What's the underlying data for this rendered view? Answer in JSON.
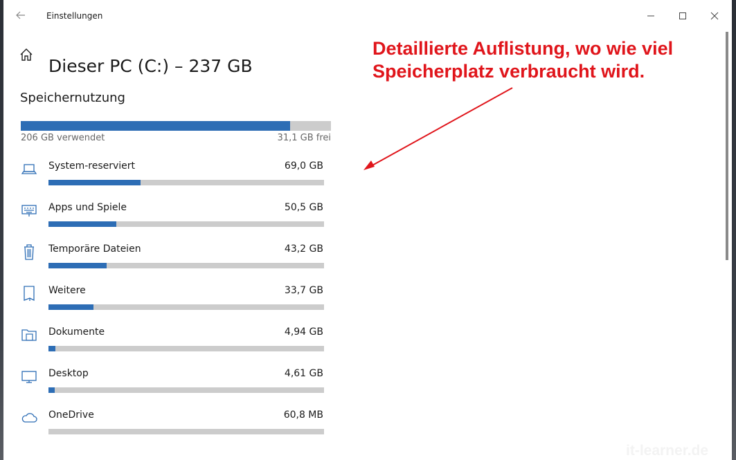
{
  "window": {
    "app_title": "Einstellungen"
  },
  "page": {
    "title": "Dieser PC (C:) – 237 GB",
    "section_title": "Speichernutzung"
  },
  "usage": {
    "used_label": "206 GB verwendet",
    "free_label": "31,1 GB frei",
    "used_fraction": 0.869
  },
  "categories": [
    {
      "icon": "laptop-icon",
      "name": "System-reserviert",
      "size": "69,0 GB",
      "fraction": 0.335
    },
    {
      "icon": "keyboard-icon",
      "name": "Apps und Spiele",
      "size": "50,5 GB",
      "fraction": 0.245
    },
    {
      "icon": "trash-icon",
      "name": "Temporäre Dateien",
      "size": "43,2 GB",
      "fraction": 0.21
    },
    {
      "icon": "document-icon",
      "name": "Weitere",
      "size": "33,7 GB",
      "fraction": 0.163
    },
    {
      "icon": "folder-icon",
      "name": "Dokumente",
      "size": "4,94 GB",
      "fraction": 0.024
    },
    {
      "icon": "monitor-icon",
      "name": "Desktop",
      "size": "4,61 GB",
      "fraction": 0.022
    },
    {
      "icon": "cloud-icon",
      "name": "OneDrive",
      "size": "60,8 MB",
      "fraction": 0.0
    }
  ],
  "annotation": {
    "text": "Detaillierte Auflistung, wo wie viel Speicherplatz verbraucht wird.",
    "color": "#e0151b"
  },
  "watermark": "it-learner.de",
  "colors": {
    "accent": "#2d6db5",
    "bar_bg": "#cccccc"
  }
}
